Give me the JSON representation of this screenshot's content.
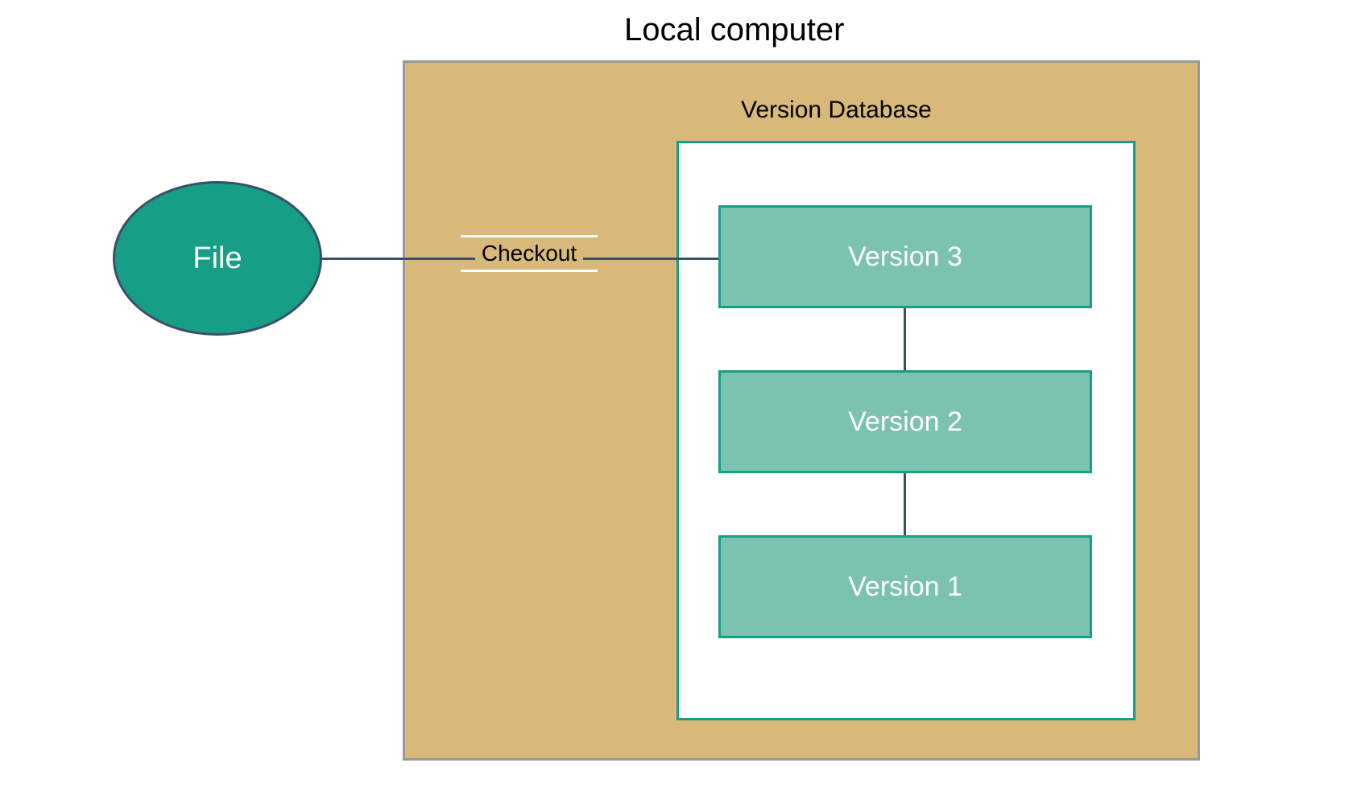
{
  "labels": {
    "title": "Local computer",
    "file": "File",
    "version_db": "Version Database",
    "checkout": "Checkout",
    "version3": "Version 3",
    "version2": "Version 2",
    "version1": "Version 1"
  },
  "colors": {
    "container_fill": "#d8b97a",
    "container_border": "#999999",
    "teal_dark": "#179e86",
    "teal_light": "#7bc3b0",
    "connector": "#3a5068",
    "db_bg": "#ffffff"
  }
}
